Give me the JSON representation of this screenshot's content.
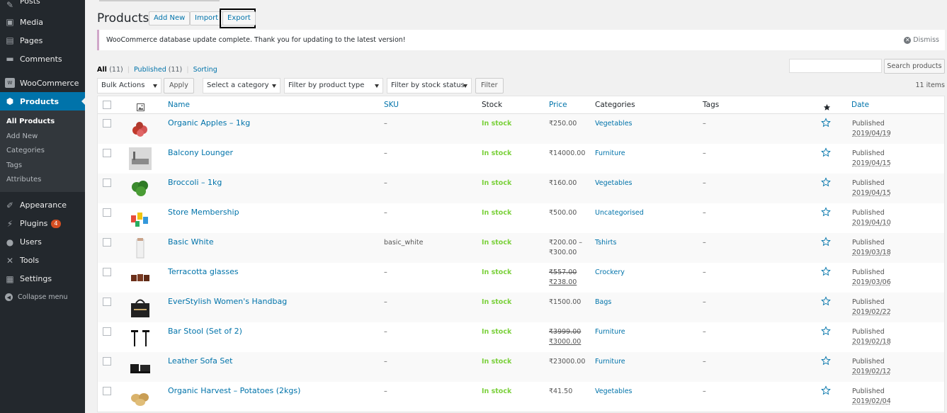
{
  "sidebar": {
    "top_items": [
      {
        "label": "Posts",
        "icon": "pin-icon"
      },
      {
        "label": "Media",
        "icon": "media-icon"
      },
      {
        "label": "Pages",
        "icon": "pages-icon"
      },
      {
        "label": "Comments",
        "icon": "comments-icon"
      }
    ],
    "woocommerce": "WooCommerce",
    "products": "Products",
    "sub": [
      "All Products",
      "Add New",
      "Categories",
      "Tags",
      "Attributes"
    ],
    "bottom_items": [
      {
        "label": "Appearance",
        "icon": "paintbrush-icon"
      },
      {
        "label": "Plugins",
        "icon": "plugin-icon",
        "badge": "4"
      },
      {
        "label": "Users",
        "icon": "users-icon"
      },
      {
        "label": "Tools",
        "icon": "wrench-icon"
      },
      {
        "label": "Settings",
        "icon": "settings-icon"
      },
      {
        "label": "Collapse menu",
        "icon": "collapse-icon"
      }
    ]
  },
  "header": {
    "title": "Products",
    "add_new": "Add New",
    "import": "Import",
    "export": "Export"
  },
  "notice": {
    "text": "WooCommerce database update complete. Thank you for updating to the latest version!",
    "dismiss": "Dismiss"
  },
  "views": {
    "all": "All",
    "all_count": "(11)",
    "published": "Published",
    "published_count": "(11)",
    "sorting": "Sorting"
  },
  "search": {
    "button": "Search products",
    "value": ""
  },
  "filters": {
    "bulk": "Bulk Actions",
    "apply": "Apply",
    "category": "Select a category",
    "type": "Filter by product type",
    "stock": "Filter by stock status",
    "filter": "Filter",
    "items": "11 items"
  },
  "columns": {
    "name": "Name",
    "sku": "SKU",
    "stock": "Stock",
    "price": "Price",
    "categories": "Categories",
    "tags": "Tags",
    "date": "Date"
  },
  "rows": [
    {
      "name": "Organic Apples – 1kg",
      "sku": "–",
      "stock": "In stock",
      "price": "₹250.00",
      "price2": "",
      "category": "Vegetables",
      "tags": "–",
      "status": "Published",
      "date": "2019/04/19",
      "thumb": "apples"
    },
    {
      "name": "Balcony Lounger",
      "sku": "–",
      "stock": "In stock",
      "price": "₹14000.00",
      "price2": "",
      "category": "Furniture",
      "tags": "–",
      "status": "Published",
      "date": "2019/04/15",
      "thumb": "lounger"
    },
    {
      "name": "Broccoli – 1kg",
      "sku": "–",
      "stock": "In stock",
      "price": "₹160.00",
      "price2": "",
      "category": "Vegetables",
      "tags": "–",
      "status": "Published",
      "date": "2019/04/15",
      "thumb": "broccoli"
    },
    {
      "name": "Store Membership",
      "sku": "–",
      "stock": "In stock",
      "price": "₹500.00",
      "price2": "",
      "category": "Uncategorised",
      "tags": "–",
      "status": "Published",
      "date": "2019/04/10",
      "thumb": "tags"
    },
    {
      "name": "Basic White",
      "sku": "basic_white",
      "stock": "In stock",
      "price": "₹200.00 –",
      "price2": "₹300.00",
      "category": "Tshirts",
      "tags": "–",
      "status": "Published",
      "date": "2019/03/18",
      "thumb": "tshirt"
    },
    {
      "name": "Terracotta glasses",
      "sku": "–",
      "stock": "In stock",
      "price_old": "₹557.00",
      "price": "",
      "price2": "₹238.00",
      "category": "Crockery",
      "tags": "–",
      "status": "Published",
      "date": "2019/03/06",
      "thumb": "glasses"
    },
    {
      "name": "EverStylish Women's Handbag",
      "sku": "–",
      "stock": "In stock",
      "price": "₹1500.00",
      "price2": "",
      "category": "Bags",
      "tags": "–",
      "status": "Published",
      "date": "2019/02/22",
      "thumb": "handbag"
    },
    {
      "name": "Bar Stool (Set of 2)",
      "sku": "–",
      "stock": "In stock",
      "price_old": "₹3999.00",
      "price": "",
      "price2": "₹3000.00",
      "category": "Furniture",
      "tags": "–",
      "status": "Published",
      "date": "2019/02/18",
      "thumb": "stool"
    },
    {
      "name": "Leather Sofa Set",
      "sku": "–",
      "stock": "In stock",
      "price": "₹23000.00",
      "price2": "",
      "category": "Furniture",
      "tags": "–",
      "status": "Published",
      "date": "2019/02/12",
      "thumb": "sofa"
    },
    {
      "name": "Organic Harvest – Potatoes (2kgs)",
      "sku": "–",
      "stock": "In stock",
      "price": "₹41.50",
      "price2": "",
      "category": "Vegetables",
      "tags": "–",
      "status": "Published",
      "date": "2019/02/04",
      "thumb": "potatoes"
    }
  ],
  "colors": {
    "accent": "#0073aa",
    "sidebar": "#23282d",
    "in_stock": "#7ad03a",
    "badge": "#d54e21"
  }
}
